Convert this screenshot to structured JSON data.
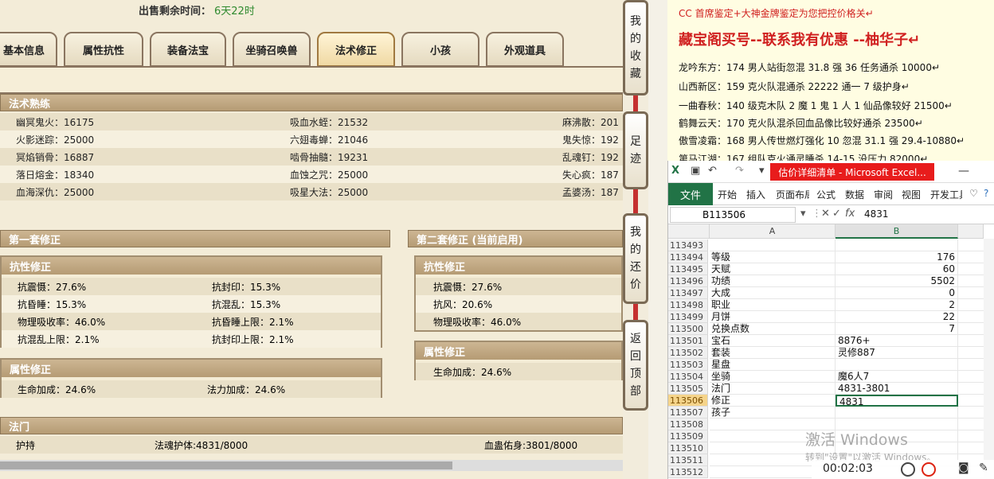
{
  "game": {
    "sale_timer": {
      "label": "出售剩余时间：",
      "value": "6天22时"
    },
    "tabs": [
      "基本信息",
      "属性抗性",
      "装备法宝",
      "坐骑召唤兽",
      "法术修正",
      "小孩",
      "外观道具"
    ],
    "active_tab": "法术修正",
    "section_proficiency": "法术熟练",
    "proficiency_rows": [
      [
        "幽冥鬼火：16175",
        "吸血水蛭：21532",
        "麻沸散：201"
      ],
      [
        "火影迷踪：25000",
        "六翅毒蝉：21046",
        "鬼失惊：192"
      ],
      [
        "冥焰销骨：16887",
        "啮骨抽髓：19231",
        "乱魂钉：192"
      ],
      [
        "落日熔金：18340",
        "血蚀之咒：25000",
        "失心疯：187"
      ],
      [
        "血海深仇：25000",
        "吸星大法：25000",
        "孟婆汤：187"
      ]
    ],
    "set1": {
      "title": "第一套修正",
      "resist_title": "抗性修正",
      "resist_rows": [
        [
          "抗震慑：27.6%",
          "抗封印：15.3%"
        ],
        [
          "抗昏睡：15.3%",
          "抗混乱：15.3%"
        ],
        [
          "物理吸收率：46.0%",
          "抗昏睡上限：2.1%"
        ],
        [
          "抗混乱上限：2.1%",
          "抗封印上限：2.1%"
        ]
      ],
      "attr_title": "属性修正",
      "attr_row": [
        "生命加成：24.6%",
        "法力加成：24.6%"
      ]
    },
    "set2": {
      "title": "第二套修正 (当前启用)",
      "resist_title": "抗性修正",
      "resist_rows": [
        "抗震慑：27.6%",
        "抗风：20.6%",
        "物理吸收率：46.0%"
      ],
      "attr_title": "属性修正",
      "attr_row": "生命加成：24.6%"
    },
    "section_fameng": "法门",
    "fameng_row": [
      "护持",
      "法魂护体:4831/8000",
      "血蛊佑身:3801/8000"
    ]
  },
  "side_buttons": [
    {
      "label": [
        "我",
        "的",
        "收",
        "藏"
      ]
    },
    {
      "label": [
        "足",
        "迹"
      ]
    },
    {
      "label": [
        "我",
        "的",
        "还",
        "价"
      ]
    },
    {
      "label": [
        "返",
        "回",
        "顶",
        "部"
      ]
    }
  ],
  "doc": {
    "line1": "CC 首席鉴定+大神金牌鉴定为您把控价格关↵",
    "headline": "藏宝阁买号--联系我有优惠 --柚华子↵",
    "lines": [
      "龙吟东方：174 男人站街忽混 31.8 强 36 任务通杀 10000↵",
      "山西新区：159 克火队混通杀 22222 通一 7 级护身↵",
      "一曲春秋：140 级克木队 2 魔 1 鬼 1 人 1 仙品像较好 21500↵",
      "鹤舞云天：170 克火队混杀回血品像比较好通杀 23500↵",
      "傲雪凌霜：168 男人传世燃灯强化 10 忽混 31.1 强 29.4-10880↵",
      "第马江湖：167 组队克火通灵睡杀 14-15 没压力 82000↵"
    ]
  },
  "excel": {
    "caption": "估价详细清单 - Microsoft Excel...",
    "ribbon_tabs": [
      "文件",
      "开始",
      "插入",
      "页面布局",
      "公式",
      "数据",
      "审阅",
      "视图",
      "开发工具"
    ],
    "name_box": "B113506",
    "formula_value": "4831",
    "columns": [
      "A",
      "B"
    ],
    "rows": [
      {
        "n": "113493",
        "a": "",
        "b": ""
      },
      {
        "n": "113494",
        "a": "等级",
        "b": "176",
        "num": true
      },
      {
        "n": "113495",
        "a": "天赋",
        "b": "60",
        "num": true
      },
      {
        "n": "113496",
        "a": "功绩",
        "b": "5502",
        "num": true
      },
      {
        "n": "113497",
        "a": "大成",
        "b": "0",
        "num": true
      },
      {
        "n": "113498",
        "a": "职业",
        "b": "2",
        "num": true
      },
      {
        "n": "113499",
        "a": "月饼",
        "b": "22",
        "num": true
      },
      {
        "n": "113500",
        "a": "兑换点数",
        "b": "7",
        "num": true
      },
      {
        "n": "113501",
        "a": "宝石",
        "b": "8876+"
      },
      {
        "n": "113502",
        "a": "套装",
        "b": "灵修887"
      },
      {
        "n": "113503",
        "a": "星盘",
        "b": ""
      },
      {
        "n": "113504",
        "a": "坐骑",
        "b": "魔6人7"
      },
      {
        "n": "113505",
        "a": "法门",
        "b": "4831-3801"
      },
      {
        "n": "113506",
        "a": "修正",
        "b": "4831",
        "active": true
      },
      {
        "n": "113507",
        "a": "孩子",
        "b": ""
      },
      {
        "n": "113508",
        "a": "",
        "b": ""
      },
      {
        "n": "113509",
        "a": "",
        "b": ""
      },
      {
        "n": "113510",
        "a": "",
        "b": ""
      },
      {
        "n": "113511",
        "a": "",
        "b": ""
      },
      {
        "n": "113512",
        "a": "",
        "b": ""
      }
    ],
    "watermark": "激活 Windows",
    "watermark_sub": "转到\"设置\"以激活 Windows。",
    "recorder_time": "00:02:03"
  },
  "colors": {
    "excel_green": "#217346",
    "title_red": "#e81c1c",
    "doc_red": "#d02020"
  }
}
